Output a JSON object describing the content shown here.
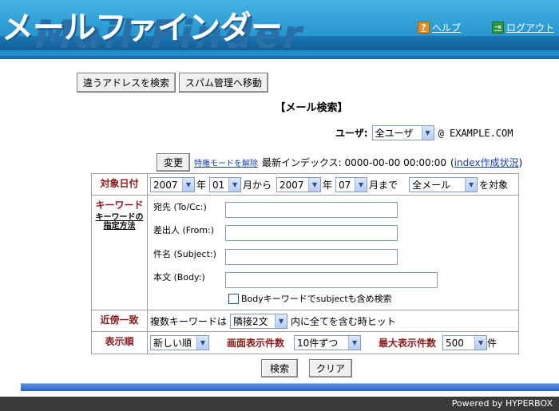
{
  "header": {
    "logo_text": "メールファインダー",
    "logo_subtext": "Mail Finder",
    "help_label": "ヘルプ",
    "logout_label": "ログアウト"
  },
  "top_buttons": {
    "search_other_address": "違うアドレスを検索",
    "go_spam_management": "スパム管理へ移動"
  },
  "page_title": "【メール検索】",
  "user": {
    "label": "ユーザ:",
    "selected": "全ユーザ",
    "domain": "@ EXAMPLE.COM"
  },
  "status": {
    "change_button": "変更",
    "mode_link": "特権モードを解除",
    "latest_index_label": "最新インデックス: 0000-00-00 00:00:00",
    "index_status_open": "(",
    "index_status_link": "index作成状況",
    "index_status_close": ")"
  },
  "date_range": {
    "label": "対象日付",
    "from_year": "2007",
    "year_suffix_1": "年",
    "from_month": "01",
    "from_suffix": "月から",
    "to_year": "2007",
    "year_suffix_2": "年",
    "to_month": "07",
    "to_suffix": "月まで",
    "mail_type": "全メール",
    "target_suffix": "を対象"
  },
  "keyword": {
    "label": "キーワード",
    "how_to_link": "キーワードの指定方法",
    "to_label": "宛先 (To/Cc:)",
    "from_label": "差出人 (From:)",
    "subject_label": "件名 (Subject:)",
    "body_label": "本文 (Body:)",
    "include_subject_label": "Bodyキーワードでsubjectも含め検索"
  },
  "proximity": {
    "label": "近傍一致",
    "prefix": "複数キーワードは",
    "selected": "隣接2文",
    "suffix": "内に全てを含む時ヒット"
  },
  "display": {
    "label": "表示順",
    "order": "新しい順",
    "per_page_label": "画面表示件数",
    "per_page": "10件ずつ",
    "max_label": "最大表示件数",
    "max": "500",
    "max_suffix": "件"
  },
  "actions": {
    "search": "検索",
    "clear": "クリア"
  },
  "footer": {
    "powered_by": "Powered by HYPERBOX"
  },
  "colors": {
    "header_blue": "#2e9ed6",
    "label_red": "#8b1a1a",
    "link_blue": "#1a3fb0"
  }
}
